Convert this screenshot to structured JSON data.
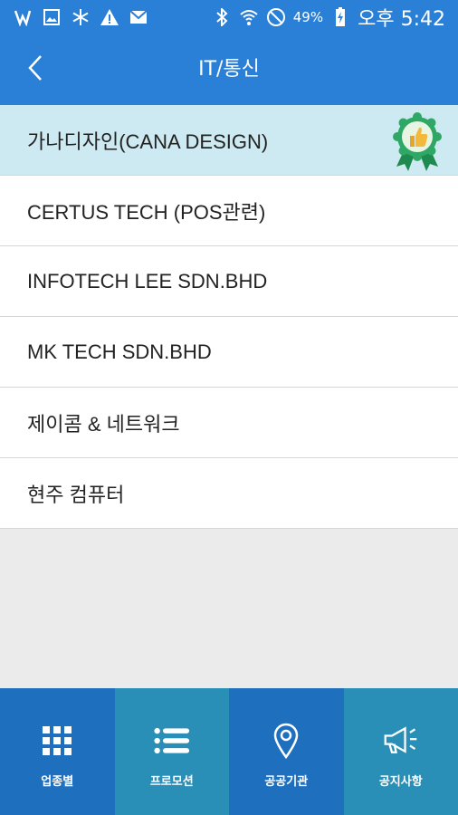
{
  "status_bar": {
    "battery_percent": "49%",
    "time": "오후 5:42",
    "icons": [
      "vpn-key-icon",
      "image-icon",
      "snowflake-icon",
      "warning-icon",
      "mail-icon",
      "bluetooth-icon",
      "wifi-icon",
      "do-not-disturb-icon",
      "battery-charging-icon"
    ]
  },
  "header": {
    "title": "IT/통신",
    "back_icon": "chevron-left-icon"
  },
  "list": {
    "items": [
      {
        "label": "가나디자인(CANA DESIGN)",
        "featured": true
      },
      {
        "label": "CERTUS TECH (POS관련)",
        "featured": false
      },
      {
        "label": "INFOTECH LEE SDN.BHD",
        "featured": false
      },
      {
        "label": "MK TECH SDN.BHD",
        "featured": false
      },
      {
        "label": "제이콤 & 네트워크",
        "featured": false
      },
      {
        "label": "현주 컴퓨터",
        "featured": false
      }
    ],
    "badge_icon": "thumbs-up-award-icon"
  },
  "tabs": [
    {
      "label": "업종별",
      "icon": "grid-icon"
    },
    {
      "label": "프로모션",
      "icon": "list-icon"
    },
    {
      "label": "공공기관",
      "icon": "map-pin-icon"
    },
    {
      "label": "공지사항",
      "icon": "megaphone-icon"
    }
  ],
  "colors": {
    "primary": "#2a7fd6",
    "featured_row": "#cde9f1",
    "tab_dark": "#1f6fbf",
    "tab_teal": "#2a8fb6",
    "badge_green": "#2fa866"
  }
}
